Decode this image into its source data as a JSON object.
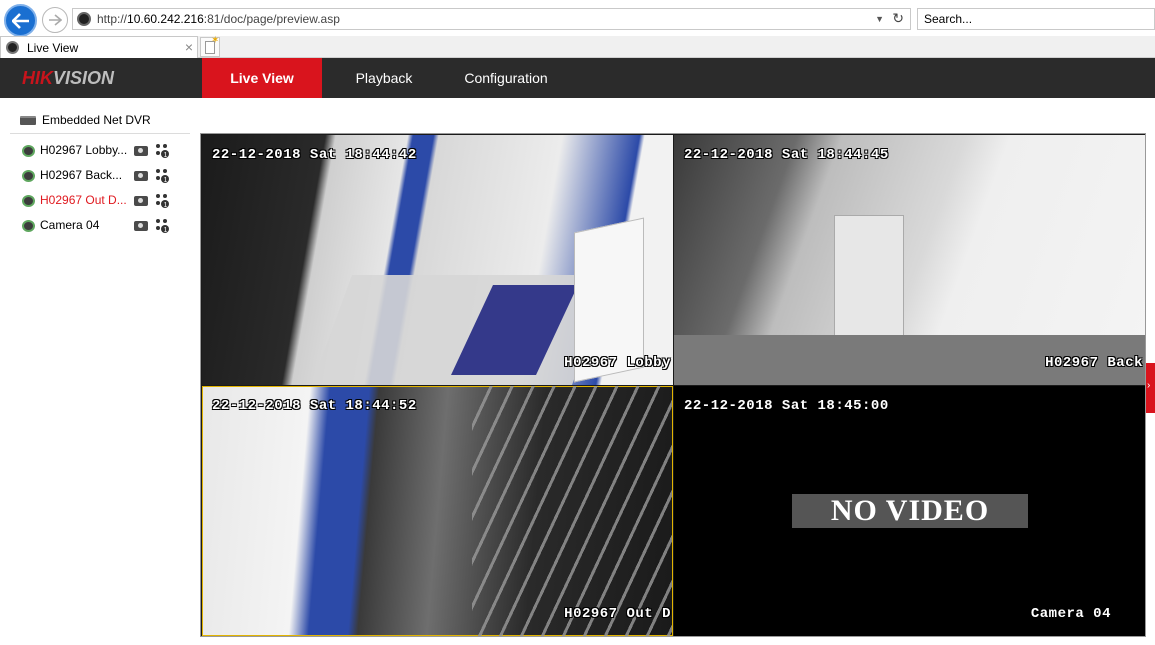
{
  "browser": {
    "url_prefix": "http://",
    "url_host": "10.60.242.216",
    "url_rest": ":81/doc/page/preview.asp",
    "search_placeholder": "Search...",
    "tab_title": "Live View",
    "tab_close": "×"
  },
  "header": {
    "logo_part1": "HIK",
    "logo_part2": "VISION",
    "nav": {
      "live_view": "Live View",
      "playback": "Playback",
      "configuration": "Configuration"
    },
    "active_tab": "Live View",
    "accent_color": "#d9141d"
  },
  "sidebar": {
    "device_name": "Embedded Net DVR",
    "cameras": [
      {
        "label": "H02967 Lobby...",
        "active": false
      },
      {
        "label": "H02967 Back...",
        "active": false
      },
      {
        "label": "H02967 Out D...",
        "active": true
      },
      {
        "label": "Camera 04",
        "active": false
      }
    ]
  },
  "grid": {
    "panes": [
      {
        "timestamp": "22-12-2018 Sat 18:44:42",
        "channel_name": "H02967 Lobby"
      },
      {
        "timestamp": "22-12-2018 Sat 18:44:45",
        "channel_name": "H02967 Back"
      },
      {
        "timestamp": "22-12-2018 Sat 18:44:52",
        "channel_name": "H02967 Out D",
        "selected": true
      },
      {
        "timestamp": "22-12-2018 Sat 18:45:00",
        "channel_name": "Camera 04",
        "no_video_text": "NO VIDEO"
      }
    ]
  },
  "icons": {
    "back": "back-arrow-icon",
    "forward": "forward-arrow-icon",
    "refresh": "refresh-icon",
    "record": "record-icon",
    "ptz": "ptz-control-icon"
  }
}
